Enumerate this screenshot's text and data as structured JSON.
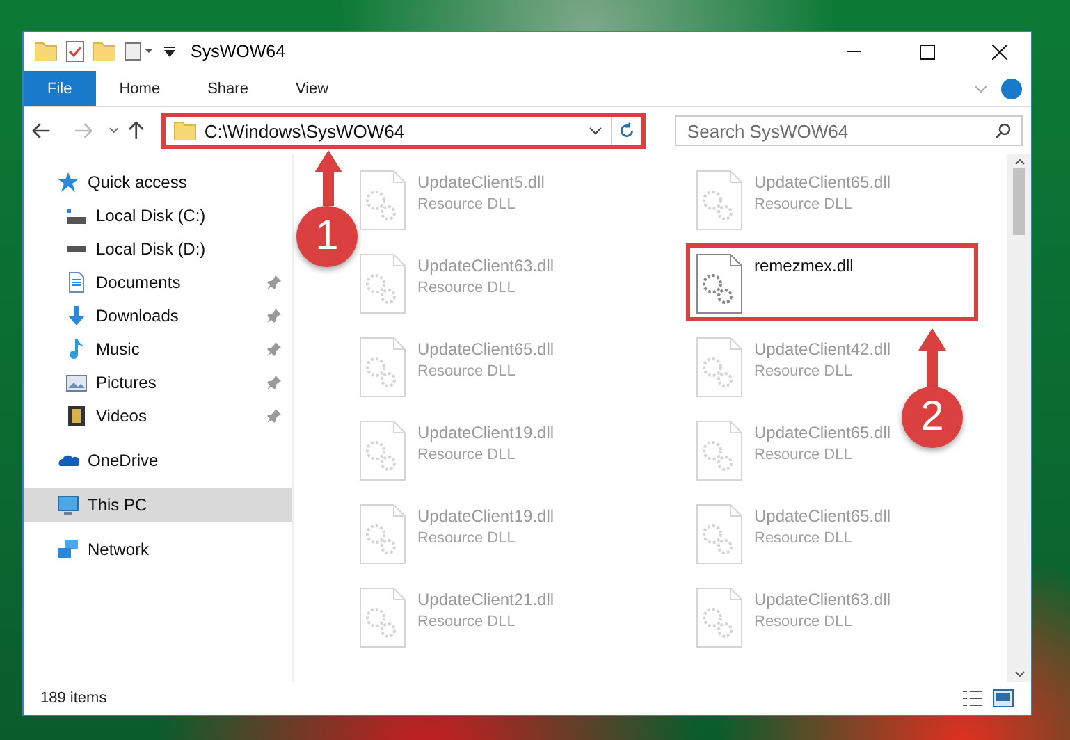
{
  "window": {
    "title": "SysWOW64"
  },
  "ribbon": {
    "tabs": [
      {
        "label": "File",
        "selected": true
      },
      {
        "label": "Home",
        "selected": false
      },
      {
        "label": "Share",
        "selected": false
      },
      {
        "label": "View",
        "selected": false
      }
    ]
  },
  "address_bar": {
    "path": "C:\\Windows\\SysWOW64",
    "highlighted": true
  },
  "search": {
    "placeholder": "Search SysWOW64"
  },
  "sidebar": {
    "items": [
      {
        "label": "Quick access",
        "kind": "star",
        "selected": false,
        "children": [
          {
            "label": "Local Disk (C:)",
            "kind": "drive-c",
            "pinned": false,
            "selected": false
          },
          {
            "label": "Local Disk (D:)",
            "kind": "drive",
            "pinned": false,
            "selected": false
          },
          {
            "label": "Documents",
            "kind": "document",
            "pinned": true,
            "selected": false
          },
          {
            "label": "Downloads",
            "kind": "download",
            "pinned": true,
            "selected": false
          },
          {
            "label": "Music",
            "kind": "music",
            "pinned": true,
            "selected": false
          },
          {
            "label": "Pictures",
            "kind": "picture",
            "pinned": true,
            "selected": false
          },
          {
            "label": "Videos",
            "kind": "video",
            "pinned": true,
            "selected": false
          }
        ]
      },
      {
        "label": "OneDrive",
        "kind": "cloud",
        "selected": false
      },
      {
        "label": "This PC",
        "kind": "computer",
        "selected": true
      },
      {
        "label": "Network",
        "kind": "network",
        "selected": false
      }
    ]
  },
  "files": [
    {
      "name": "UpdateClient5.dll",
      "type": "Resource DLL",
      "dimmed": true,
      "highlighted": false
    },
    {
      "name": "UpdateClient65.dll",
      "type": "Resource DLL",
      "dimmed": true,
      "highlighted": false
    },
    {
      "name": "UpdateClient63.dll",
      "type": "Resource DLL",
      "dimmed": true,
      "highlighted": false
    },
    {
      "name": "remezmex.dll",
      "dimmed": false,
      "highlighted": true
    },
    {
      "name": "UpdateClient65.dll",
      "type": "Resource DLL",
      "dimmed": true,
      "highlighted": false
    },
    {
      "name": "UpdateClient42.dll",
      "type": "Resource DLL",
      "dimmed": true,
      "highlighted": false
    },
    {
      "name": "UpdateClient19.dll",
      "type": "Resource DLL",
      "dimmed": true,
      "highlighted": false
    },
    {
      "name": "UpdateClient65.dll",
      "type": "Resource DLL",
      "dimmed": true,
      "highlighted": false
    },
    {
      "name": "UpdateClient19.dll",
      "type": "Resource DLL",
      "dimmed": true,
      "highlighted": false
    },
    {
      "name": "UpdateClient65.dll",
      "type": "Resource DLL",
      "dimmed": true,
      "highlighted": false
    },
    {
      "name": "UpdateClient21.dll",
      "type": "Resource DLL",
      "dimmed": true,
      "highlighted": false
    },
    {
      "name": "UpdateClient63.dll",
      "type": "Resource DLL",
      "dimmed": true,
      "highlighted": false
    }
  ],
  "status_bar": {
    "item_count": "189 items"
  },
  "annotations": [
    {
      "number": "1"
    },
    {
      "number": "2"
    }
  ]
}
